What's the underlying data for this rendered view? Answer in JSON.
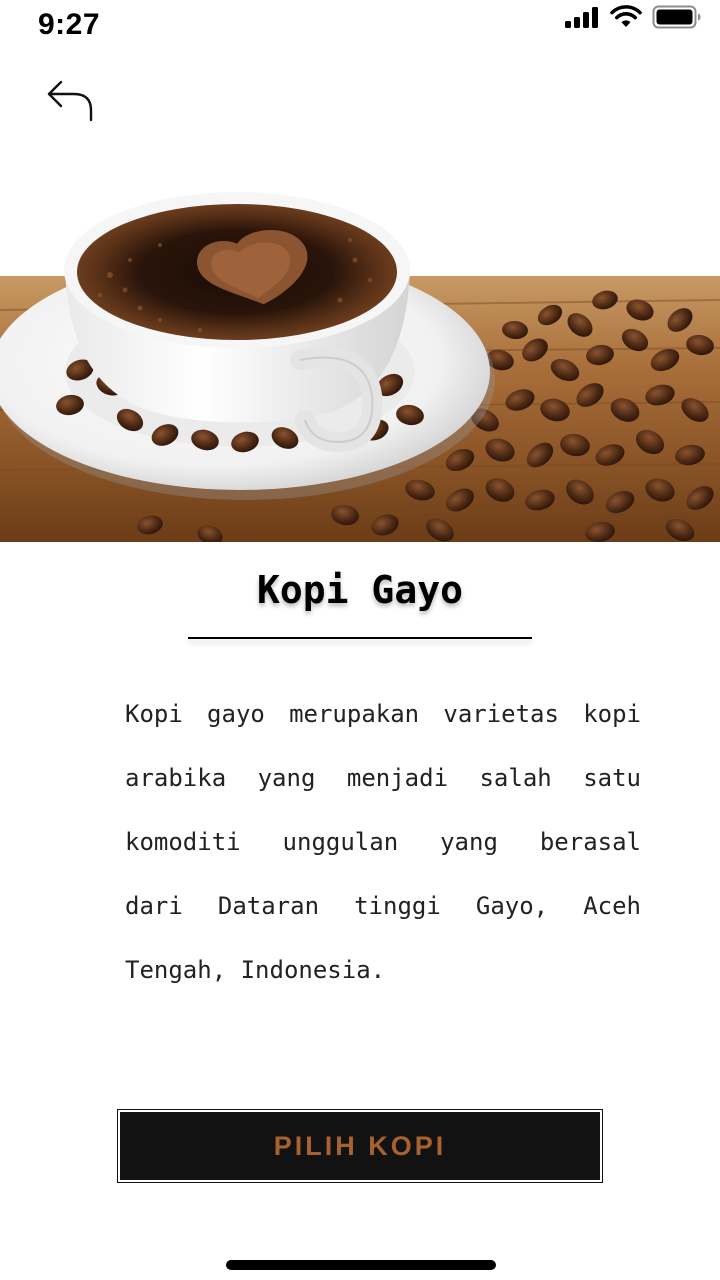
{
  "status_bar": {
    "time": "9:27",
    "icons": [
      "cellular-signal-icon",
      "wifi-icon",
      "battery-icon"
    ]
  },
  "header": {
    "back_icon": "back-arrow-icon"
  },
  "hero": {
    "image": "coffee-cup-with-beans-image"
  },
  "product": {
    "title": "Kopi Gayo",
    "description_lines": [
      "Kopi gayo merupakan varietas kopi",
      "arabika yang menjadi salah satu",
      "komoditi unggulan yang berasal",
      "dari Dataran tinggi Gayo, Aceh",
      "Tengah, Indonesia."
    ]
  },
  "cta": {
    "label": "PILIH KOPI"
  },
  "colors": {
    "button_bg": "#121212",
    "button_text": "#a8622f",
    "text": "#222222"
  }
}
